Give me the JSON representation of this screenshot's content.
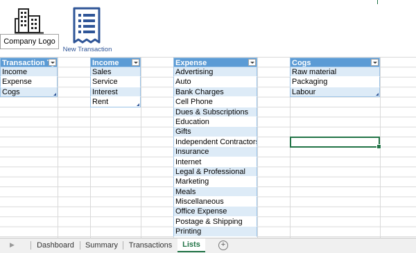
{
  "header": {
    "logo_label": "Company Logo",
    "new_transaction_label": "New Transaction"
  },
  "tables": {
    "transaction_type": {
      "header": "Transaction Ty",
      "rows": [
        "Income",
        "Expense",
        "Cogs"
      ]
    },
    "income": {
      "header": "Income",
      "rows": [
        "Sales",
        "Service",
        "Interest",
        "Rent"
      ]
    },
    "expense": {
      "header": "Expense",
      "rows": [
        "Advertising",
        "Auto",
        "Bank Charges",
        "Cell Phone",
        "Dues & Subscriptions",
        "Education",
        "Gifts",
        "Independent Contractors",
        "Insurance",
        "Internet",
        "Legal & Professional",
        "Marketing",
        "Meals",
        "Miscellaneous",
        "Office Expense",
        "Postage & Shipping",
        "Printing"
      ]
    },
    "cogs": {
      "header": "Cogs",
      "rows": [
        "Raw material",
        "Packaging",
        "Labour"
      ]
    }
  },
  "sheet_tabs": {
    "tabs": [
      "Dashboard",
      "Summary",
      "Transactions",
      "Lists"
    ],
    "active": "Lists",
    "add_symbol": "+"
  },
  "colors": {
    "table_header": "#5b9bd5",
    "band": "#ddebf7",
    "selection": "#217346",
    "icon": "#2f5597"
  }
}
